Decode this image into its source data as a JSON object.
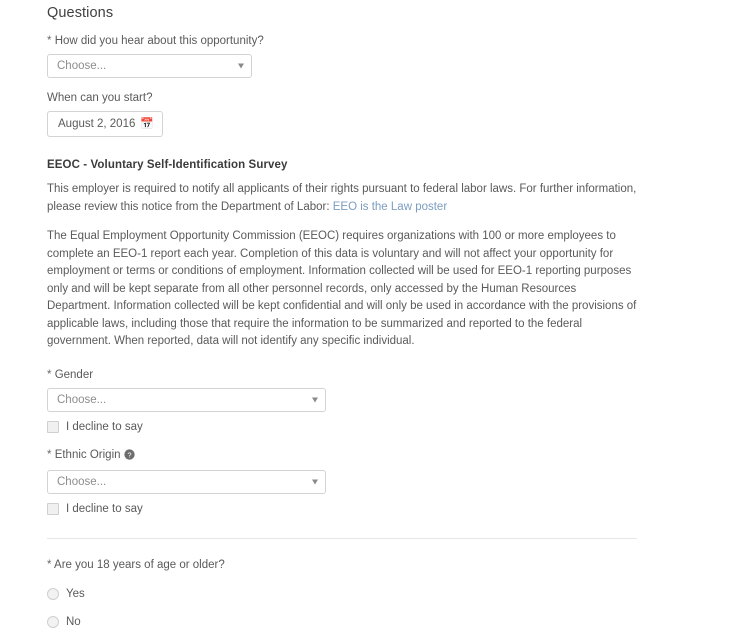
{
  "section": {
    "title": "Questions"
  },
  "hear_about": {
    "label": "How did you hear about this opportunity?",
    "required_mark": "*",
    "value": "Choose...",
    "caret_icon": "chevron-down-icon"
  },
  "start_date": {
    "label": "When can you start?",
    "value": "August 2, 2016",
    "calendar_icon": "calendar-icon",
    "calendar_glyph": "Ὄ5"
  },
  "eeoc": {
    "heading": "EEOC - Voluntary Self-Identification Survey",
    "notice_prefix": "This employer is required to notify all applicants of their rights pursuant to federal labor laws. For further information, please review this notice from the Department of Labor: ",
    "notice_link_text": "EEO is the Law poster",
    "link_color": "#7a9cc0",
    "body": "The Equal Employment Opportunity Commission (EEOC) requires organizations with 100 or more employees to complete an EEO-1 report each year. Completion of this data is voluntary and will not affect your opportunity for employment or terms or conditions of employment. Information collected will be used for EEO-1 reporting purposes only and will be kept separate from all other personnel records, only accessed by the Human Resources Department. Information collected will be kept confidential and will only be used in accordance with the provisions of applicable laws, including those that require the information to be summarized and reported to the federal government. When reported, data will not identify any specific individual."
  },
  "gender": {
    "label": "Gender",
    "required_mark": "*",
    "value": "Choose...",
    "decline_label": "I decline to say",
    "decline_checked": false
  },
  "ethnic_origin": {
    "label": "Ethnic Origin",
    "required_mark": "*",
    "help_icon": "help-question-icon",
    "value": "Choose...",
    "decline_label": "I decline to say",
    "decline_checked": false
  },
  "age_question": {
    "label": "Are you 18 years of age or older?",
    "required_mark": "*",
    "options": [
      {
        "label": "Yes",
        "selected": false
      },
      {
        "label": "No",
        "selected": false
      }
    ]
  }
}
